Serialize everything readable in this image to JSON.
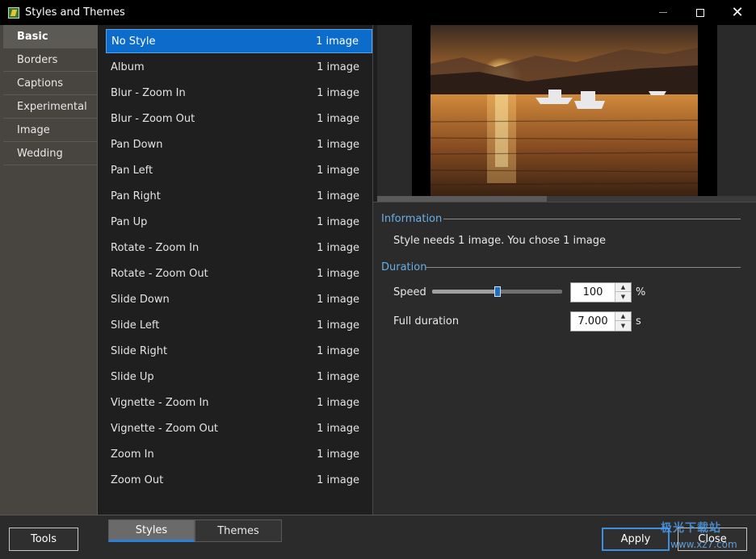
{
  "window": {
    "title": "Styles and Themes"
  },
  "categories": [
    {
      "label": "Basic",
      "active": true
    },
    {
      "label": "Borders",
      "active": false
    },
    {
      "label": "Captions",
      "active": false
    },
    {
      "label": "Experimental",
      "active": false
    },
    {
      "label": "Image",
      "active": false
    },
    {
      "label": "Wedding",
      "active": false
    }
  ],
  "styles": [
    {
      "name": "No Style",
      "count": "1 image",
      "selected": true
    },
    {
      "name": "Album",
      "count": "1 image"
    },
    {
      "name": "Blur - Zoom In",
      "count": "1 image"
    },
    {
      "name": "Blur - Zoom Out",
      "count": "1 image"
    },
    {
      "name": "Pan Down",
      "count": "1 image"
    },
    {
      "name": "Pan Left",
      "count": "1 image"
    },
    {
      "name": "Pan Right",
      "count": "1 image"
    },
    {
      "name": "Pan Up",
      "count": "1 image"
    },
    {
      "name": "Rotate - Zoom In",
      "count": "1 image"
    },
    {
      "name": "Rotate - Zoom Out",
      "count": "1 image"
    },
    {
      "name": "Slide Down",
      "count": "1 image"
    },
    {
      "name": "Slide Left",
      "count": "1 image"
    },
    {
      "name": "Slide Right",
      "count": "1 image"
    },
    {
      "name": "Slide Up",
      "count": "1 image"
    },
    {
      "name": "Vignette - Zoom In",
      "count": "1 image"
    },
    {
      "name": "Vignette - Zoom Out",
      "count": "1 image"
    },
    {
      "name": "Zoom In",
      "count": "1 image"
    },
    {
      "name": "Zoom Out",
      "count": "1 image"
    }
  ],
  "info": {
    "title": "Information",
    "text": "Style needs 1 image. You chose 1 image"
  },
  "duration": {
    "title": "Duration",
    "speed_label": "Speed",
    "speed_value": "100",
    "speed_unit": "%",
    "speed_slider_fraction": 0.5,
    "full_duration_label": "Full duration",
    "full_duration_value": "7.000",
    "full_duration_unit": "s"
  },
  "footer": {
    "tools_label": "Tools",
    "tabs": [
      {
        "label": "Styles",
        "active": true
      },
      {
        "label": "Themes",
        "active": false
      }
    ],
    "apply_label": "Apply",
    "close_label": "Close"
  },
  "watermark": {
    "text": "极光下载站",
    "url": "www.xz7.com"
  },
  "colors": {
    "accent": "#0c6ccc",
    "section_title": "#6aaee6",
    "sidebar_bg": "#484540"
  }
}
